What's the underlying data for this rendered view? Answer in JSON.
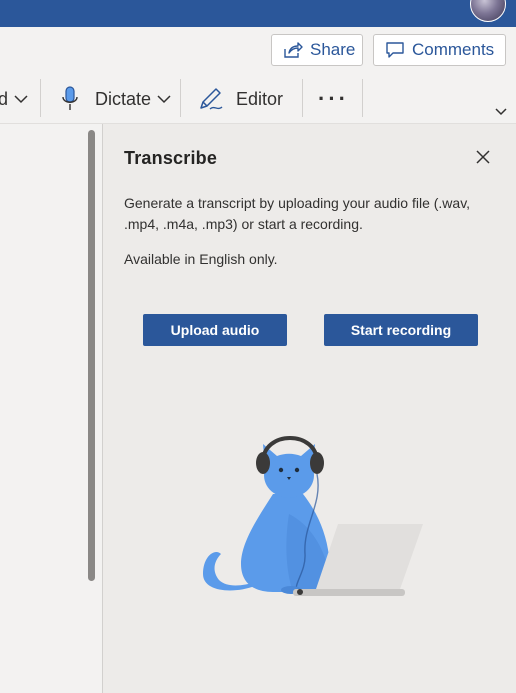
{
  "header": {
    "share_label": "Share",
    "comments_label": "Comments"
  },
  "ribbon": {
    "partial_label": "d",
    "dictate_label": "Dictate",
    "editor_label": "Editor",
    "more_label": "···"
  },
  "transcribe": {
    "title": "Transcribe",
    "description": "Generate a transcript by uploading your audio file (.wav, .mp4, .m4a, .mp3) or start a recording.",
    "note": "Available in English only.",
    "upload_label": "Upload audio",
    "record_label": "Start recording"
  },
  "colors": {
    "brand": "#2b579a",
    "pane_bg": "#edebe9",
    "cat": "#5b9bea"
  },
  "icons": [
    "share-icon",
    "comment-icon",
    "microphone-icon",
    "editor-pen-icon",
    "close-icon",
    "chevron-down-icon"
  ]
}
